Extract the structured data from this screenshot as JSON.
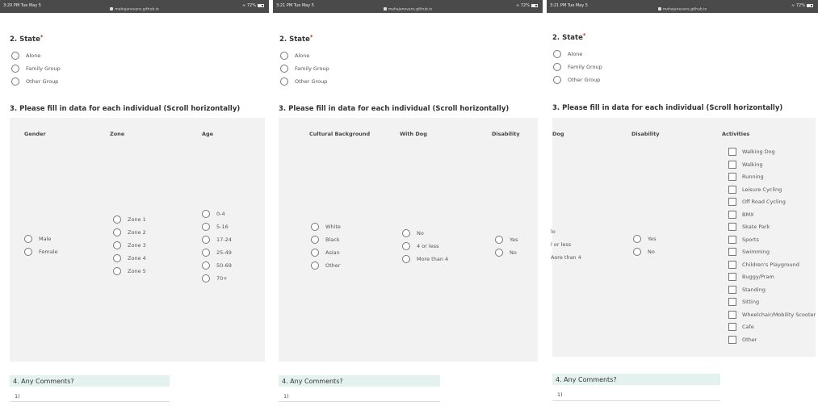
{
  "url": "mahajanevans.github.io",
  "panels": [
    {
      "status": {
        "time": "3:20 PM  Tue May 5",
        "battery": "72%"
      },
      "q2": {
        "number": "2.",
        "title": "State",
        "options": [
          "Alone",
          "Family Group",
          "Other Group"
        ]
      },
      "q3": {
        "title": "3. Please fill in data for each individual (Scroll horizontally)"
      },
      "columns": [
        {
          "header": "Gender",
          "options": [
            "Male",
            "Female"
          ]
        },
        {
          "header": "Zone",
          "options": [
            "Zone 1",
            "Zone 2",
            "Zone 3",
            "Zone 4",
            "Zone 5"
          ]
        },
        {
          "header": "Age",
          "options": [
            "0-4",
            "5-16",
            "17-24",
            "25-49",
            "50-69",
            "70+"
          ]
        }
      ],
      "q4": {
        "title": "4. Any Comments?",
        "answer": "1)"
      }
    },
    {
      "status": {
        "time": "3:21 PM  Tue May 5",
        "battery": "72%"
      },
      "q2": {
        "number": "2.",
        "title": "State",
        "options": [
          "Alone",
          "Family Group",
          "Other Group"
        ]
      },
      "q3": {
        "title": "3. Please fill in data for each individual (Scroll horizontally)"
      },
      "columns": [
        {
          "header": "Cultural Background",
          "options": [
            "White",
            "Black",
            "Asian",
            "Other"
          ]
        },
        {
          "header": "With Dog",
          "options": [
            "No",
            "4 or less",
            "More than 4"
          ]
        },
        {
          "header": "Disability",
          "options": [
            "Yes",
            "No"
          ]
        }
      ],
      "q4": {
        "title": "4. Any Comments?",
        "answer": "1)"
      }
    },
    {
      "status": {
        "time": "3:21 PM  Tue May 5",
        "battery": "72%"
      },
      "q2": {
        "number": "2.",
        "title": "State",
        "options": [
          "Alone",
          "Family Group",
          "Other Group"
        ]
      },
      "q3": {
        "title": "3. Please fill in data for each individual (Scroll horizontally)"
      },
      "columns": [
        {
          "header": "Dog",
          "options": [
            "lo",
            "l or less",
            "Aore than 4"
          ]
        },
        {
          "header": "Disability",
          "options": [
            "Yes",
            "No"
          ]
        },
        {
          "header": "Activities",
          "options": [
            "Walking Dog",
            "Walking",
            "Running",
            "Leisure Cycling",
            "Off Road Cycling",
            "BMX",
            "Skate Park",
            "Sports",
            "Swimming",
            "Children's Playground",
            "Buggy/Pram",
            "Standing",
            "Sitting",
            "Wheelchair/Mobility Scooter",
            "Cafe",
            "Other"
          ]
        }
      ],
      "q4": {
        "title": "4. Any Comments?",
        "answer": "1)"
      }
    }
  ],
  "colors": {
    "statusbar": "#4a4a4a",
    "grid_bg": "#f2f2f2",
    "comments_bg": "#e3f2ef",
    "required": "#c0392b"
  }
}
